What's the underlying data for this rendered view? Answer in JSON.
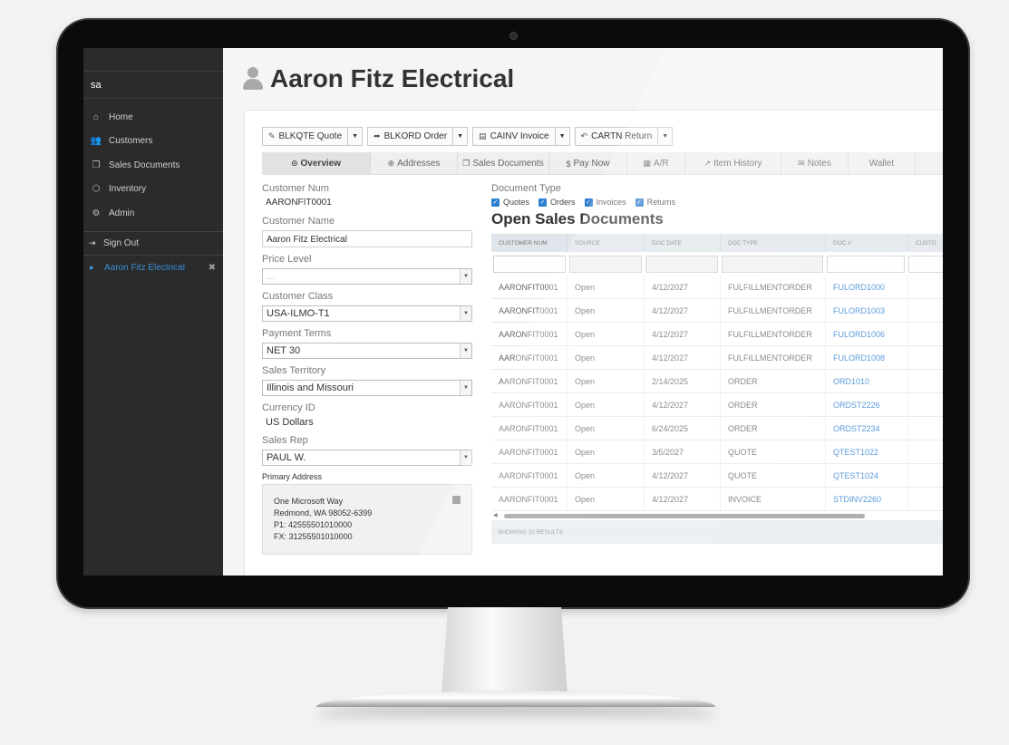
{
  "sidebar": {
    "user": "sa",
    "items": [
      {
        "label": "Home",
        "icon": "home-icon",
        "glyph": "⌂"
      },
      {
        "label": "Customers",
        "icon": "users-icon",
        "glyph": "👥"
      },
      {
        "label": "Sales Documents",
        "icon": "documents-icon",
        "glyph": "❐"
      },
      {
        "label": "Inventory",
        "icon": "cubes-icon",
        "glyph": "⬡"
      },
      {
        "label": "Admin",
        "icon": "gears-icon",
        "glyph": "⚙"
      }
    ],
    "signout": "Sign Out",
    "account": "Aaron Fitz Electrical"
  },
  "page": {
    "title": "Aaron Fitz Electrical"
  },
  "toolbar": [
    {
      "label": "BLKQTE Quote",
      "glyph": "✎"
    },
    {
      "label": "BLKORD Order",
      "glyph": "➦"
    },
    {
      "label": "CAINV Invoice",
      "glyph": "▤"
    },
    {
      "label": "CARTN Return",
      "glyph": "↶"
    }
  ],
  "tabs": [
    {
      "label": "Overview",
      "glyph": "⊙",
      "active": true
    },
    {
      "label": "Addresses",
      "glyph": "⊕"
    },
    {
      "label": "Sales Documents",
      "glyph": "❐"
    },
    {
      "label": "Pay Now",
      "glyph": "$"
    },
    {
      "label": "A/R",
      "glyph": "▦"
    },
    {
      "label": "Item History",
      "glyph": "↗"
    },
    {
      "label": "Notes",
      "glyph": "✉"
    },
    {
      "label": "Wallet",
      "glyph": ""
    }
  ],
  "form": {
    "customer_num_label": "Customer Num",
    "customer_num": "AARONFIT0001",
    "customer_name_label": "Customer Name",
    "customer_name": "Aaron Fitz Electrical",
    "price_level_label": "Price Level",
    "price_level": "...",
    "customer_class_label": "Customer Class",
    "customer_class": "USA-ILMO-T1",
    "payment_terms_label": "Payment Terms",
    "payment_terms": "NET 30",
    "sales_territory_label": "Sales Territory",
    "sales_territory": "Illinois and Missouri",
    "currency_label": "Currency ID",
    "currency": "US Dollars",
    "sales_rep_label": "Sales Rep",
    "sales_rep": "PAUL W.",
    "primary_address_label": "Primary Address",
    "address": {
      "line1": "One Microsoft Way",
      "line2": "Redmond, WA 98052-6399",
      "phone1": "P1: 42555501010000",
      "fax": "FX: 31255501010000"
    }
  },
  "documents": {
    "type_label": "Document Type",
    "filters": [
      "Quotes",
      "Orders",
      "Invoices",
      "Returns"
    ],
    "heading": "Open Sales Documents",
    "columns": [
      "Customer Num",
      "Source",
      "Doc Date",
      "Doc Type",
      "Doc #",
      "Custo"
    ],
    "rows": [
      [
        "AARONFIT0001",
        "Open",
        "4/12/2027",
        "FULFILLMENTORDER",
        "FULORD1000"
      ],
      [
        "AARONFIT0001",
        "Open",
        "4/12/2027",
        "FULFILLMENTORDER",
        "FULORD1003"
      ],
      [
        "AARONFIT0001",
        "Open",
        "4/12/2027",
        "FULFILLMENTORDER",
        "FULORD1006"
      ],
      [
        "AARONFIT0001",
        "Open",
        "4/12/2027",
        "FULFILLMENTORDER",
        "FULORD1008"
      ],
      [
        "AARONFIT0001",
        "Open",
        "2/14/2025",
        "ORDER",
        "ORD1010"
      ],
      [
        "AARONFIT0001",
        "Open",
        "4/12/2027",
        "ORDER",
        "ORDST2226"
      ],
      [
        "AARONFIT0001",
        "Open",
        "6/24/2025",
        "ORDER",
        "ORDST2234"
      ],
      [
        "AARONFIT0001",
        "Open",
        "3/5/2027",
        "QUOTE",
        "QTEST1022"
      ],
      [
        "AARONFIT0001",
        "Open",
        "4/12/2027",
        "QUOTE",
        "QTEST1024"
      ],
      [
        "AARONFIT0001",
        "Open",
        "4/12/2027",
        "INVOICE",
        "STDINV2260"
      ]
    ],
    "footer": "Showing 10 results"
  },
  "colors": {
    "accent": "#2d7fd0",
    "sidebar_bg": "#2b2b2b"
  }
}
